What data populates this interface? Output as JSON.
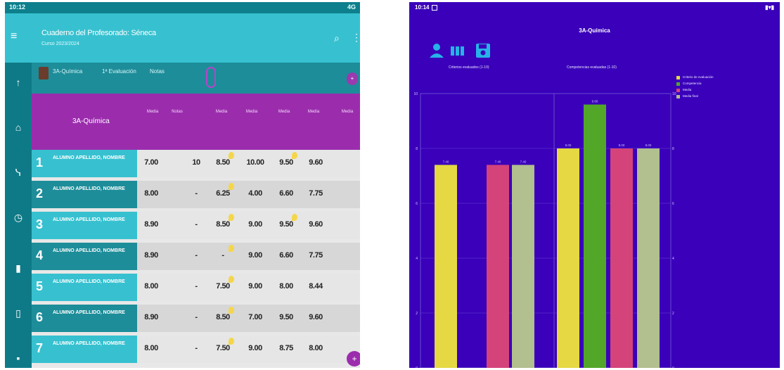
{
  "left": {
    "status": {
      "time": "10:12",
      "signal": "4G"
    },
    "appbar": {
      "title": "Cuaderno del Profesorado: Séneca",
      "subtitle": "Curso 2023/2024"
    },
    "tabs": [
      "3A-Química",
      "1ª Evaluación",
      "Notas"
    ],
    "columns": [
      "Media",
      "Notas",
      "Media",
      "Media",
      "Media",
      "Media",
      "Media"
    ],
    "header_name": "3A-Química",
    "rows": [
      {
        "num": "1",
        "name": "ALUMNO APELLIDO, NOMBRE",
        "values": [
          "7.00",
          "10",
          "8.50",
          "10.00",
          "9.50",
          "9.60"
        ],
        "flags": [
          2,
          4
        ]
      },
      {
        "num": "2",
        "name": "ALUMNO APELLIDO, NOMBRE",
        "values": [
          "8.00",
          "-",
          "6.25",
          "4.00",
          "6.60",
          "7.75"
        ],
        "flags": [
          2
        ]
      },
      {
        "num": "3",
        "name": "ALUMNO APELLIDO, NOMBRE",
        "values": [
          "8.90",
          "-",
          "8.50",
          "9.00",
          "9.50",
          "9.60"
        ],
        "flags": [
          2,
          4
        ]
      },
      {
        "num": "4",
        "name": "ALUMNO APELLIDO, NOMBRE",
        "values": [
          "8.90",
          "-",
          "-",
          "9.00",
          "6.60",
          "7.75"
        ],
        "flags": [
          2
        ]
      },
      {
        "num": "5",
        "name": "ALUMNO APELLIDO, NOMBRE",
        "values": [
          "8.00",
          "-",
          "7.50",
          "9.00",
          "8.00",
          "8.44"
        ],
        "flags": [
          2
        ]
      },
      {
        "num": "6",
        "name": "ALUMNO APELLIDO, NOMBRE",
        "values": [
          "8.90",
          "-",
          "8.50",
          "7.00",
          "9.50",
          "9.60"
        ],
        "flags": [
          2
        ]
      },
      {
        "num": "7",
        "name": "ALUMNO APELLIDO, NOMBRE",
        "values": [
          "8.00",
          "-",
          "7.50",
          "9.00",
          "8.75",
          "8.00"
        ],
        "flags": [
          2
        ]
      }
    ]
  },
  "right": {
    "status": {
      "time": "10:14",
      "signal": "▮▾▮"
    },
    "title": "3A-Química",
    "label_a": "Criterios evaluados (1-10)",
    "label_b": "Competencias evaluadas (1-10)",
    "legend": [
      {
        "label": "Criterio de evaluación",
        "color": "#e5d842"
      },
      {
        "label": "Competencia",
        "color": "#52a728"
      },
      {
        "label": "Media",
        "color": "#d4447a"
      },
      {
        "label": "Media final",
        "color": "#b2bf8e"
      }
    ],
    "colors": {
      "background": "#3a00ba",
      "grid": "#6a4ad0"
    }
  },
  "chart_data": {
    "type": "bar",
    "title": "3A-Química",
    "ylim": [
      0,
      10
    ],
    "yticks": [
      0,
      2,
      4,
      6,
      8,
      10
    ],
    "groups": [
      {
        "bars": [
          {
            "series": 0,
            "value": 7.4
          },
          {
            "series": 2,
            "value": 7.4
          },
          {
            "series": 3,
            "value": 7.4
          }
        ]
      },
      {
        "bars": [
          {
            "series": 0,
            "value": 8.0
          },
          {
            "series": 1,
            "value": 9.6
          },
          {
            "series": 2,
            "value": 8.0
          },
          {
            "series": 3,
            "value": 8.0
          }
        ]
      }
    ],
    "series_colors": [
      "#e5d842",
      "#52a728",
      "#d4447a",
      "#b2bf8e"
    ],
    "grid": true
  }
}
